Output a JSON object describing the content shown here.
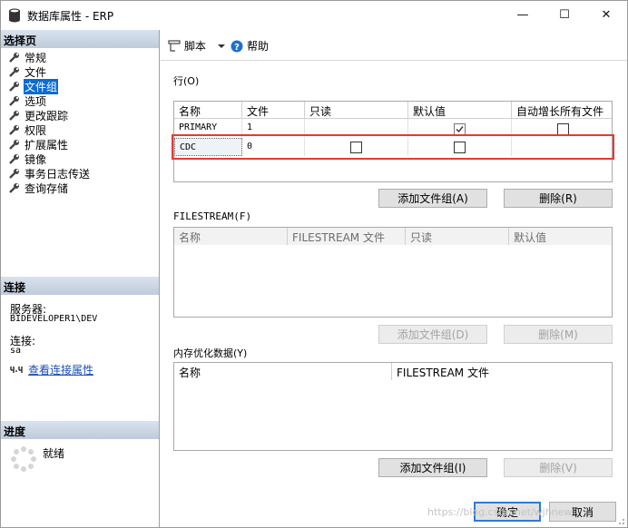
{
  "window": {
    "title": "数据库属性 - ERP",
    "minimize_glyph": "—",
    "maximize_glyph": "☐",
    "close_glyph": "✕"
  },
  "left_pane": {
    "select_page_header": "选择页",
    "items": [
      {
        "label": "常规",
        "selected": false
      },
      {
        "label": "文件",
        "selected": false
      },
      {
        "label": "文件组",
        "selected": true
      },
      {
        "label": "选项",
        "selected": false
      },
      {
        "label": "更改跟踪",
        "selected": false
      },
      {
        "label": "权限",
        "selected": false
      },
      {
        "label": "扩展属性",
        "selected": false
      },
      {
        "label": "镜像",
        "selected": false
      },
      {
        "label": "事务日志传送",
        "selected": false
      },
      {
        "label": "查询存储",
        "selected": false
      }
    ],
    "connection_header": "连接",
    "server_label": "服务器:",
    "server_value": "BIDEVELOPER1\\DEV",
    "connection_label": "连接:",
    "connection_value": "sa",
    "view_connection_link": "查看连接属性",
    "progress_header": "进度",
    "progress_status": "就绪"
  },
  "toolbar": {
    "script_label": "脚本",
    "help_label": "帮助"
  },
  "rows_section": {
    "label": "行(O)",
    "columns": [
      "名称",
      "文件",
      "只读",
      "默认值",
      "自动增长所有文件"
    ],
    "rows": [
      {
        "name": "PRIMARY",
        "files": "1",
        "readonly": false,
        "default": true,
        "autogrow": false
      },
      {
        "name": "CDC",
        "files": "0",
        "readonly": false,
        "default": false,
        "autogrow": null
      }
    ],
    "add_button": "添加文件组(A)",
    "delete_button": "删除(R)"
  },
  "filestream_section": {
    "label": "FILESTREAM(F)",
    "columns": [
      "名称",
      "FILESTREAM 文件",
      "只读",
      "默认值"
    ],
    "add_button": "添加文件组(D)",
    "delete_button": "删除(M)"
  },
  "memory_section": {
    "label": "内存优化数据(Y)",
    "columns": [
      "名称",
      "FILESTREAM 文件"
    ],
    "add_button": "添加文件组(I)",
    "delete_button": "删除(V)"
  },
  "footer": {
    "ok_button": "确定",
    "cancel_button": "取消",
    "watermark": "https://blog.csdn.net/wjhnew"
  },
  "colors": {
    "selection": "#0a6ad6",
    "highlight_border": "#e53935",
    "link": "#1a4fb8"
  }
}
